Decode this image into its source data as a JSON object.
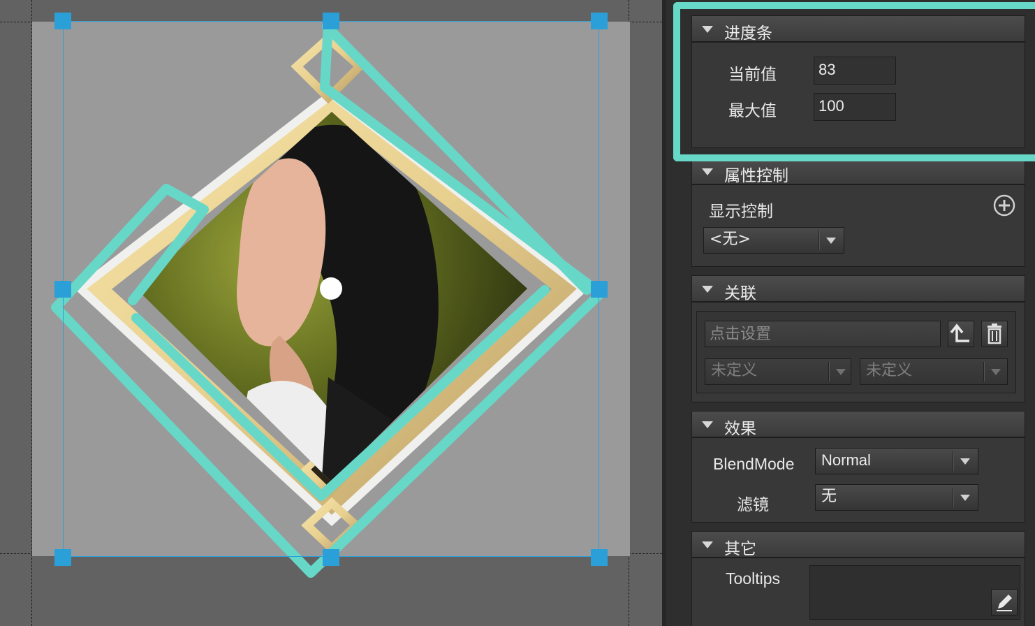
{
  "canvas": {
    "image_description_alt": "",
    "pivot_icon": "pivot-point-icon"
  },
  "panel": {
    "progress": {
      "title": "进度条",
      "current_label": "当前值",
      "current_value": "83",
      "max_label": "最大值",
      "max_value": "100"
    },
    "attribute_control": {
      "title": "属性控制",
      "display_label": "显示控制",
      "add_icon": "plus-circle-icon",
      "display_select": "<无>"
    },
    "relation": {
      "title": "关联",
      "input_placeholder": "点击设置",
      "upload_icon": "arrow-up-icon",
      "delete_icon": "trash-icon",
      "select_left": "未定义",
      "select_right": "未定义"
    },
    "effects": {
      "title": "效果",
      "blend_label": "BlendMode",
      "blend_value": "Normal",
      "filter_label": "滤镜",
      "filter_value": "无"
    },
    "other": {
      "title": "其它",
      "tooltips_label": "Tooltips",
      "edit_icon": "pencil-icon"
    }
  },
  "colors": {
    "highlight": "#67d7c8",
    "selection": "#2b9fdc",
    "panel_bg": "#2e2e2e"
  }
}
